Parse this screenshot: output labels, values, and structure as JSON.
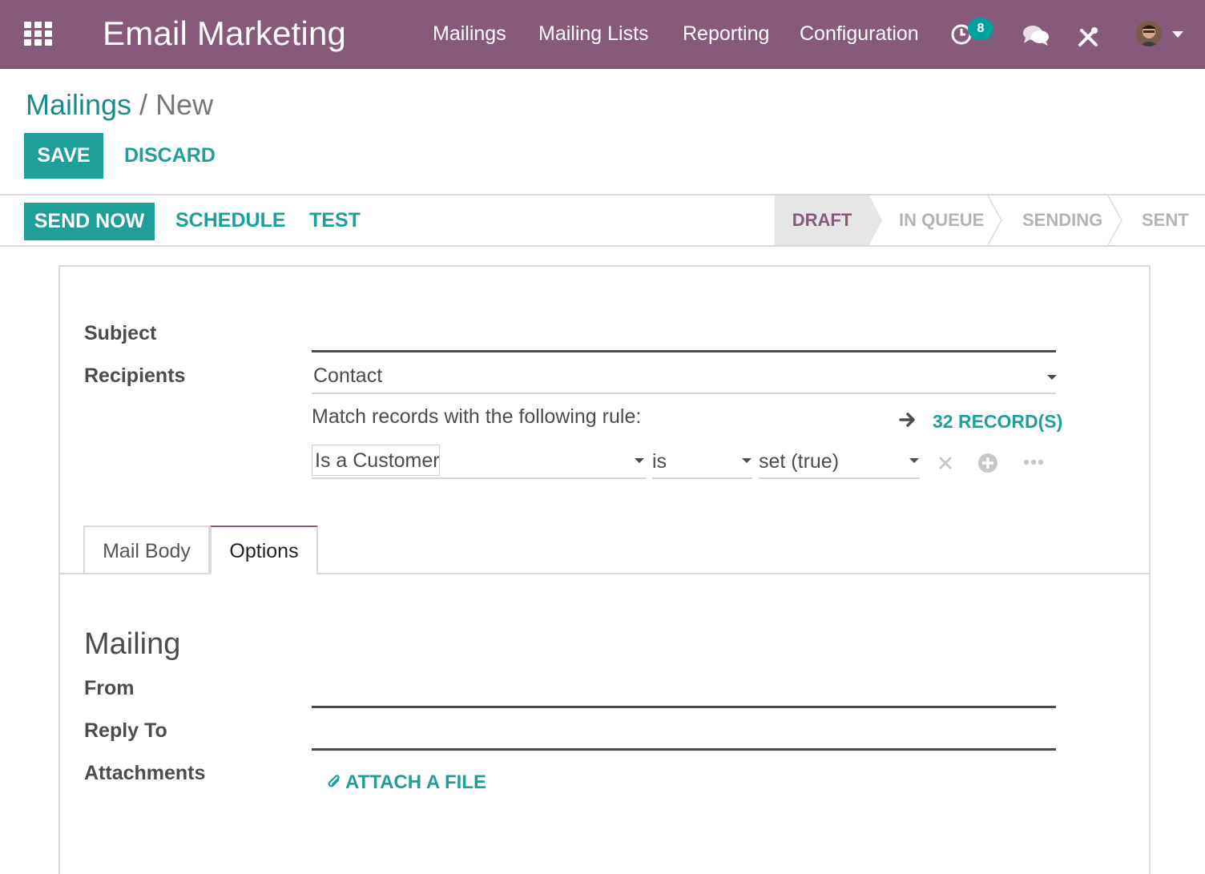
{
  "navbar": {
    "app_title": "Email Marketing",
    "menu": [
      "Mailings",
      "Mailing Lists",
      "Reporting",
      "Configuration"
    ],
    "activity_count": "8",
    "icons": [
      "apps-grid-icon",
      "activity-clock-icon",
      "chat-icon",
      "tools-icon",
      "user-avatar",
      "chevron-down-icon"
    ],
    "color": "#875a7b"
  },
  "breadcrumb": {
    "parent": "Mailings",
    "separator": "/",
    "current": "New"
  },
  "actions": {
    "save": "SAVE",
    "discard": "DISCARD"
  },
  "statusbar": {
    "buttons": {
      "send_now": "SEND NOW",
      "schedule": "SCHEDULE",
      "test": "TEST"
    },
    "stages": [
      "DRAFT",
      "IN QUEUE",
      "SENDING",
      "SENT"
    ],
    "active_stage": "DRAFT"
  },
  "form": {
    "subject_label": "Subject",
    "subject_value": "",
    "recipients_label": "Recipients",
    "recipients_value": "Contact",
    "rule_text": "Match records with the following rule:",
    "records_link": "32 RECORD(S)",
    "rule": {
      "field": "Is a Customer",
      "operator": "is",
      "value": "set (true)"
    }
  },
  "tabs": {
    "items": [
      "Mail Body",
      "Options"
    ],
    "active": "Options"
  },
  "options_section": {
    "title": "Mailing",
    "from_label": "From",
    "from_value": "",
    "reply_to_label": "Reply To",
    "reply_to_value": "",
    "attachments_label": "Attachments",
    "attach_button": "ATTACH A FILE"
  },
  "colors": {
    "brand": "#875a7b",
    "accent": "#1f9f9a",
    "badge": "#00a09d"
  }
}
